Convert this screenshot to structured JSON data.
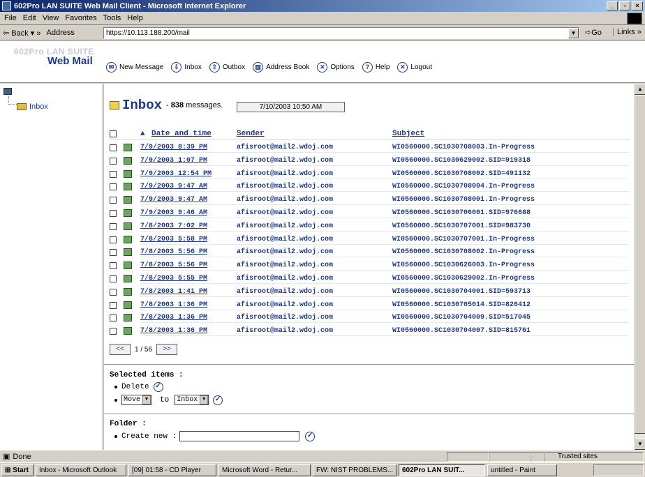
{
  "window": {
    "title": "602Pro LAN SUITE Web Mail Client - Microsoft Internet Explorer"
  },
  "menu": [
    "File",
    "Edit",
    "View",
    "Favorites",
    "Tools",
    "Help"
  ],
  "toolbar": {
    "back": "Back",
    "address_label": "Address",
    "url": "https://10.113.188.200/mail",
    "go": "Go",
    "links": "Links"
  },
  "app": {
    "logo_top": "602Pro LAN SUITE",
    "logo_bottom": "Web Mail"
  },
  "nav": [
    "New Message",
    "Inbox",
    "Outbox",
    "Address Book",
    "Options",
    "Help",
    "Logout"
  ],
  "sidebar": {
    "folder": "Inbox"
  },
  "inbox": {
    "title": "Inbox",
    "count": "838",
    "count_suffix": "messages.",
    "prefix": "-",
    "datetime": "7/10/2003 10:50 AM"
  },
  "columns": {
    "date": "Date and time",
    "sender": "Sender",
    "subject": "Subject"
  },
  "messages": [
    {
      "date": "7/9/2003 8:39 PM",
      "sender": "afisroot@mail2.wdoj.com",
      "subject": "WI0560000.SC1030708003.In-Progress"
    },
    {
      "date": "7/9/2003 1:07 PM",
      "sender": "afisroot@mail2.wdoj.com",
      "subject": "WI0560000.SC1030629002.SID=919318"
    },
    {
      "date": "7/9/2003 12:54 PM",
      "sender": "afisroot@mail2.wdoj.com",
      "subject": "WI0560000.SC1030708002.SID=491132"
    },
    {
      "date": "7/9/2003 9:47 AM",
      "sender": "afisroot@mail2.wdoj.com",
      "subject": "WI0560000.SC1030708004.In-Progress"
    },
    {
      "date": "7/9/2003 9:47 AM",
      "sender": "afisroot@mail2.wdoj.com",
      "subject": "WI0560000.SC1030708001.In-Progress"
    },
    {
      "date": "7/9/2003 9:46 AM",
      "sender": "afisroot@mail2.wdoj.com",
      "subject": "WI0560000.SC1030706001.SID=976688"
    },
    {
      "date": "7/8/2003 7:02 PM",
      "sender": "afisroot@mail2.wdoj.com",
      "subject": "WI0560000.SC1030707001.SID=983730"
    },
    {
      "date": "7/8/2003 5:58 PM",
      "sender": "afisroot@mail2.wdoj.com",
      "subject": "WI0560000.SC1030707001.In-Progress"
    },
    {
      "date": "7/8/2003 5:56 PM",
      "sender": "afisroot@mail2.wdoj.com",
      "subject": "WI0560000.SC1030708002.In-Progress"
    },
    {
      "date": "7/8/2003 5:56 PM",
      "sender": "afisroot@mail2.wdoj.com",
      "subject": "WI0560000.SC1030626003.In-Progress"
    },
    {
      "date": "7/8/2003 5:55 PM",
      "sender": "afisroot@mail2.wdoj.com",
      "subject": "WI0560000.SC1030629002.In-Progress"
    },
    {
      "date": "7/8/2003 1:41 PM",
      "sender": "afisroot@mail2.wdoj.com",
      "subject": "WI0560000.SC1030704001.SID=593713"
    },
    {
      "date": "7/8/2003 1:36 PM",
      "sender": "afisroot@mail2.wdoj.com",
      "subject": "WI0560000.SC1030705014.SID=826412"
    },
    {
      "date": "7/8/2003 1:36 PM",
      "sender": "afisroot@mail2.wdoj.com",
      "subject": "WI0560000.SC1030704009.SID=517045"
    },
    {
      "date": "7/8/2003 1:36 PM",
      "sender": "afisroot@mail2.wdoj.com",
      "subject": "WI0560000.SC1030704007.SID=815761"
    }
  ],
  "pager": {
    "prev": "<<",
    "next": ">>",
    "page": "1 / 56"
  },
  "selected": {
    "label": "Selected items :",
    "delete": "Delete",
    "move": "Move",
    "to": "to",
    "target": "Inbox"
  },
  "folder": {
    "label": "Folder :",
    "create": "Create new :"
  },
  "status": {
    "left": "Done",
    "zone": "Trusted sites"
  },
  "taskbar": {
    "start": "Start",
    "items": [
      "Inbox - Microsoft Outlook",
      "[09] 01:58 - CD Player",
      "Microsoft Word - Retur...",
      "FW: NIST PROBLEMS...",
      "602Pro LAN SUIT...",
      "untitled - Paint"
    ]
  }
}
